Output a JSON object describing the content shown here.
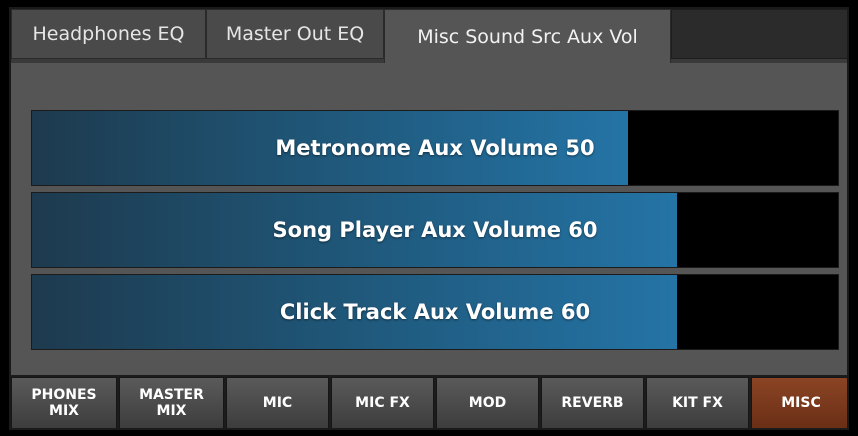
{
  "tabs": [
    {
      "label": "Headphones EQ",
      "active": false
    },
    {
      "label": "Master Out EQ",
      "active": false
    },
    {
      "label": "Misc Sound Src Aux Vol",
      "active": true
    }
  ],
  "sliders": [
    {
      "label": "Metronome Aux Volume 50",
      "value": 50,
      "fill_percent": 74
    },
    {
      "label": "Song Player Aux Volume 60",
      "value": 60,
      "fill_percent": 80
    },
    {
      "label": "Click Track Aux Volume 60",
      "value": 60,
      "fill_percent": 80
    }
  ],
  "nav": {
    "phones_mix": {
      "line1": "PHONES",
      "line2": "MIX"
    },
    "master_mix": {
      "line1": "MASTER",
      "line2": "MIX"
    },
    "mic": "MIC",
    "mic_fx": "MIC FX",
    "mod": "MOD",
    "reverb": "REVERB",
    "kit_fx": "KIT FX",
    "misc": "MISC",
    "active": "MISC"
  },
  "colors": {
    "accent_active": "#8b4424",
    "slider_fill": "#2474a6",
    "panel": "#555555"
  }
}
